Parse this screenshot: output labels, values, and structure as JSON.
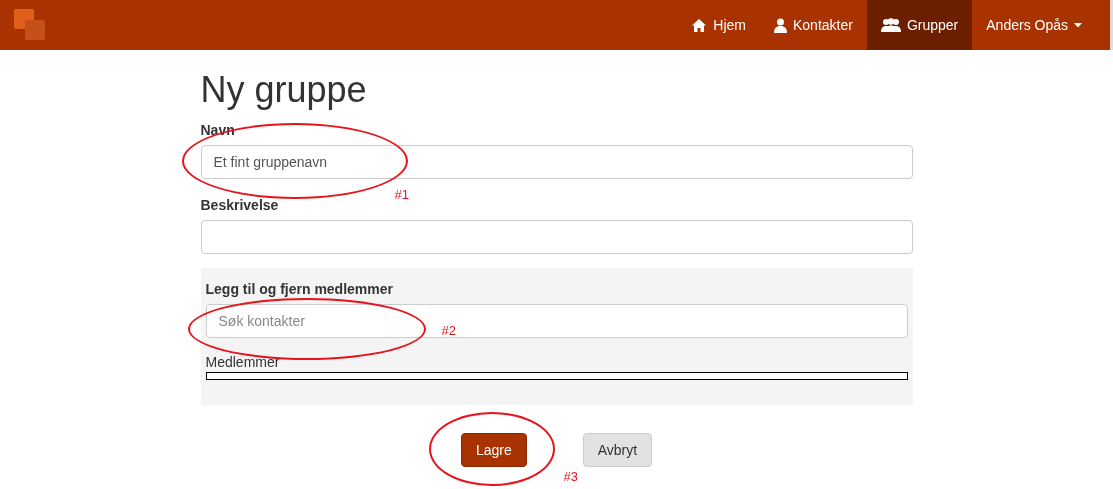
{
  "navbar": {
    "items": [
      {
        "label": "Hjem",
        "selected": false
      },
      {
        "label": "Kontakter",
        "selected": false
      },
      {
        "label": "Grupper",
        "selected": true
      }
    ],
    "user_menu": {
      "label": "Anders Opås"
    }
  },
  "form": {
    "title": "Ny gruppe",
    "fields": [
      {
        "label": "Navn",
        "value": "Et fint gruppenavn"
      },
      {
        "label": "Beskrivelse"
      }
    ],
    "members_panel": {
      "title": "Legg til og fjern medlemmer",
      "search": {
        "placeholder": "Søk kontakter"
      },
      "list_label": "Medlemmer"
    },
    "buttons": [
      {
        "label": "Lagre",
        "kind": "primary"
      },
      {
        "label": "Avbryt",
        "kind": "default"
      }
    ]
  },
  "annotations": [
    {
      "label": "#1"
    },
    {
      "label": "#2"
    },
    {
      "label": "#3"
    }
  ]
}
